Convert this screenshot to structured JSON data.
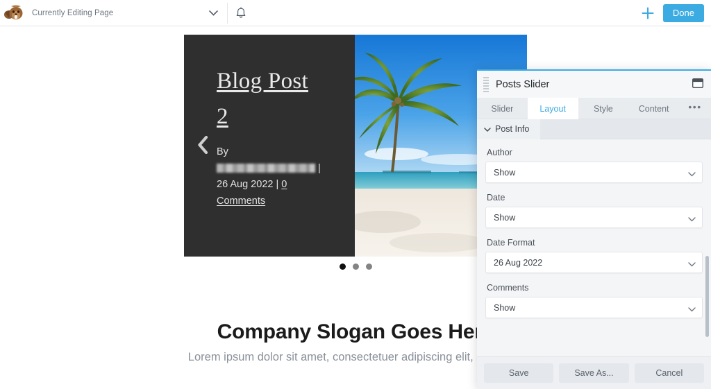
{
  "adminbar": {
    "logo_icon": "beaver-logo-icon",
    "title": "Currently Editing Page",
    "chevron_icon": "chevron-down-icon",
    "bell_icon": "bell-icon",
    "plus_icon": "plus-icon",
    "done_label": "Done",
    "accent_color": "#3cabe2"
  },
  "canvas": {
    "slider": {
      "prev_icon": "chevron-left-icon",
      "post_title": "Blog Post 2",
      "by_label": "By",
      "author_name": "",
      "separator": "|",
      "date": "26 Aug 2022",
      "comment_count": "0",
      "comments_label": "Comments",
      "image_alt": "palm-tree-beach-photo",
      "dots": [
        {
          "active": true
        },
        {
          "active": false
        },
        {
          "active": false
        }
      ]
    },
    "slogan": "Company Slogan Goes Here",
    "subslogan": "Lorem ipsum dolor sit amet, consectetuer adipiscing elit, sed diam"
  },
  "panel": {
    "title": "Posts Slider",
    "drag_handle_icon": "drag-handle-icon",
    "dock_icon": "dock-window-icon",
    "tabs": [
      {
        "label": "Slider",
        "active": false
      },
      {
        "label": "Layout",
        "active": true
      },
      {
        "label": "Style",
        "active": false
      },
      {
        "label": "Content",
        "active": false
      }
    ],
    "more_label": "•••",
    "section": {
      "label": "Post Info",
      "chevron_icon": "chevron-down-icon",
      "expanded": true
    },
    "fields": [
      {
        "label": "Author",
        "value": "Show",
        "name": "author"
      },
      {
        "label": "Date",
        "value": "Show",
        "name": "date"
      },
      {
        "label": "Date Format",
        "value": "26 Aug 2022",
        "name": "date-format"
      },
      {
        "label": "Comments",
        "value": "Show",
        "name": "comments"
      }
    ],
    "footer": {
      "save_label": "Save",
      "save_as_label": "Save As...",
      "cancel_label": "Cancel"
    }
  }
}
